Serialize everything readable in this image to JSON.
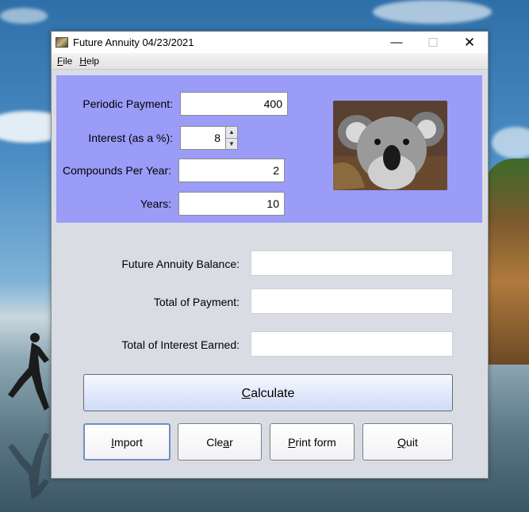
{
  "window": {
    "title": "Future Annuity 04/23/2021",
    "min_symbol": "—",
    "max_symbol": "☐",
    "close_symbol": "✕"
  },
  "menu": {
    "file": {
      "mnemonic": "F",
      "rest": "ile"
    },
    "help": {
      "mnemonic": "H",
      "rest": "elp"
    }
  },
  "inputs": {
    "periodic_payment": {
      "label": "Periodic Payment:",
      "value": "400"
    },
    "interest": {
      "label": "Interest (as a %):",
      "value": "8"
    },
    "compounds": {
      "label": "Compounds Per Year:",
      "value": "2"
    },
    "years": {
      "label": "Years:",
      "value": "10"
    }
  },
  "outputs": {
    "future_balance": {
      "label": "Future Annuity Balance:",
      "value": ""
    },
    "total_payment": {
      "label": "Total of Payment:",
      "value": ""
    },
    "total_interest": {
      "label": "Total of Interest Earned:",
      "value": ""
    }
  },
  "buttons": {
    "calculate": {
      "mnemonic": "C",
      "rest": "alculate"
    },
    "import": {
      "mnemonic": "I",
      "rest": "mport"
    },
    "clear": {
      "pre": "Cle",
      "mnemonic": "a",
      "rest": "r"
    },
    "print": {
      "mnemonic": "P",
      "rest": "rint form"
    },
    "quit": {
      "mnemonic": "Q",
      "rest": "uit"
    }
  },
  "colors": {
    "input_panel": "#9b9bf8",
    "window_bg": "#dadce4",
    "calc_button": "#cfdcf7"
  },
  "icons": {
    "app": "koala-app-icon",
    "spinner_up": "arrow-up-icon",
    "spinner_down": "arrow-down-icon"
  }
}
